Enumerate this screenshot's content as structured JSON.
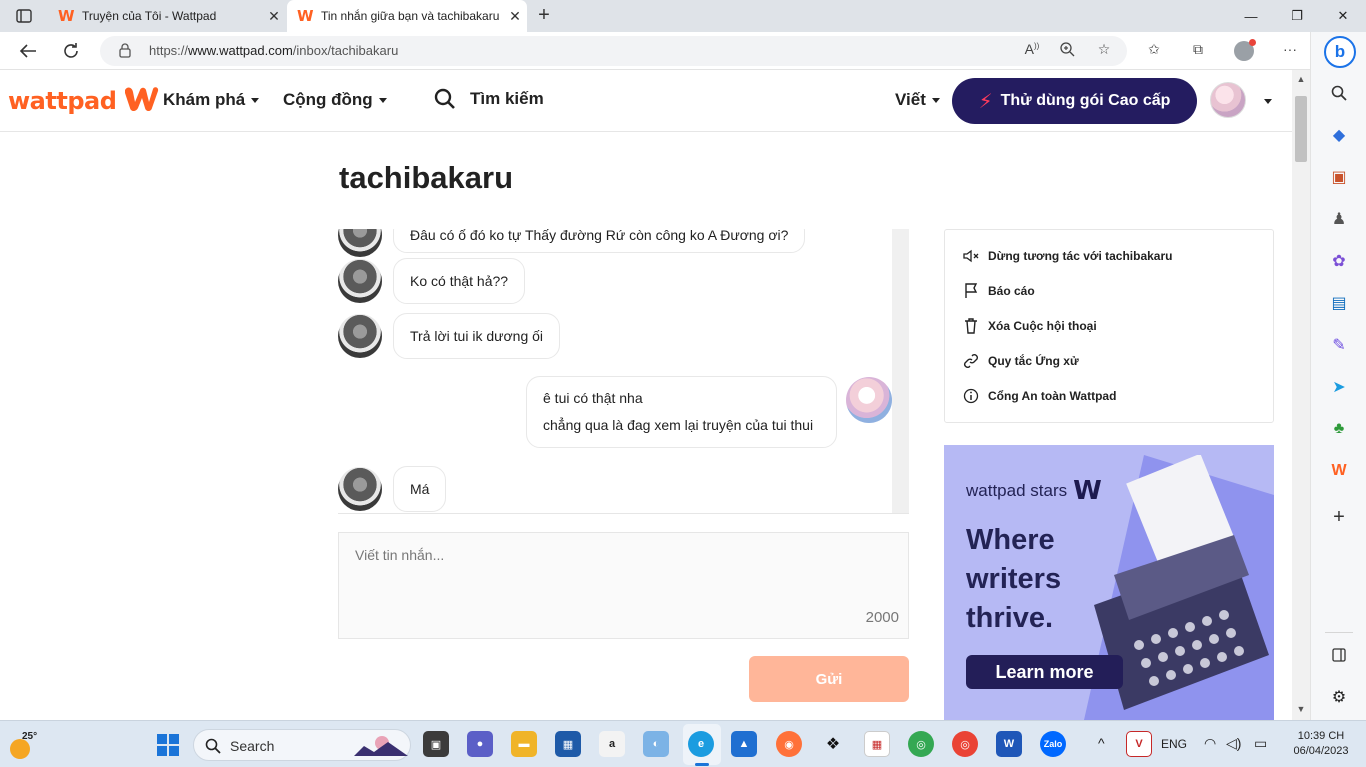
{
  "browser": {
    "tabs": [
      {
        "title": "Truyện của Tôi - Wattpad",
        "active": false
      },
      {
        "title": "Tin nhắn giữa bạn và tachibakaru",
        "active": true
      }
    ],
    "url_prefix": "https://",
    "url_host": "www.wattpad.com",
    "url_path": "/inbox/tachibakaru"
  },
  "header": {
    "logo": "wattpad",
    "nav": [
      {
        "label": "Khám phá"
      },
      {
        "label": "Cộng đồng"
      }
    ],
    "search_label": "Tìm kiếm",
    "write_label": "Viết",
    "premium_label": "Thử dùng gói Cao cấp",
    "accent": "#ff6122",
    "premium_bg": "#241c60"
  },
  "conversation": {
    "title": "tachibakaru",
    "partial_message": "Đâu có ổ đó ko tự Thấy đường Rứ còn công ko A Đương ơi?",
    "messages": [
      {
        "from": "them",
        "text": "Ko có thật hả??"
      },
      {
        "from": "them",
        "text": "Trả lời tui ik dương ối"
      },
      {
        "from": "me",
        "lines": [
          "ê tui có thật nha",
          "chẳng qua là đag xem lại truyện của tui thui"
        ]
      },
      {
        "from": "them",
        "text": "Má"
      }
    ],
    "compose_placeholder": "Viết tin nhắn...",
    "char_limit": "2000",
    "send_label": "Gửi"
  },
  "side_menu": [
    {
      "icon": "mute-icon",
      "label": "Dừng tương tác với tachibakaru"
    },
    {
      "icon": "flag-icon",
      "label": "Báo cáo"
    },
    {
      "icon": "trash-icon",
      "label": "Xóa Cuộc hội thoại"
    },
    {
      "icon": "link-icon",
      "label": "Quy tắc Ứng xử"
    },
    {
      "icon": "info-icon",
      "label": "Cổng An toàn Wattpad"
    }
  ],
  "ad": {
    "brand": "wattpad stars",
    "headline_lines": [
      "Where",
      "writers",
      "thrive."
    ],
    "cta": "Learn more",
    "bg": "#b6b9f4"
  },
  "taskbar": {
    "temperature": "25°",
    "search_label": "Search",
    "language": "ENG",
    "time": "10:39 CH",
    "date": "06/04/2023"
  }
}
